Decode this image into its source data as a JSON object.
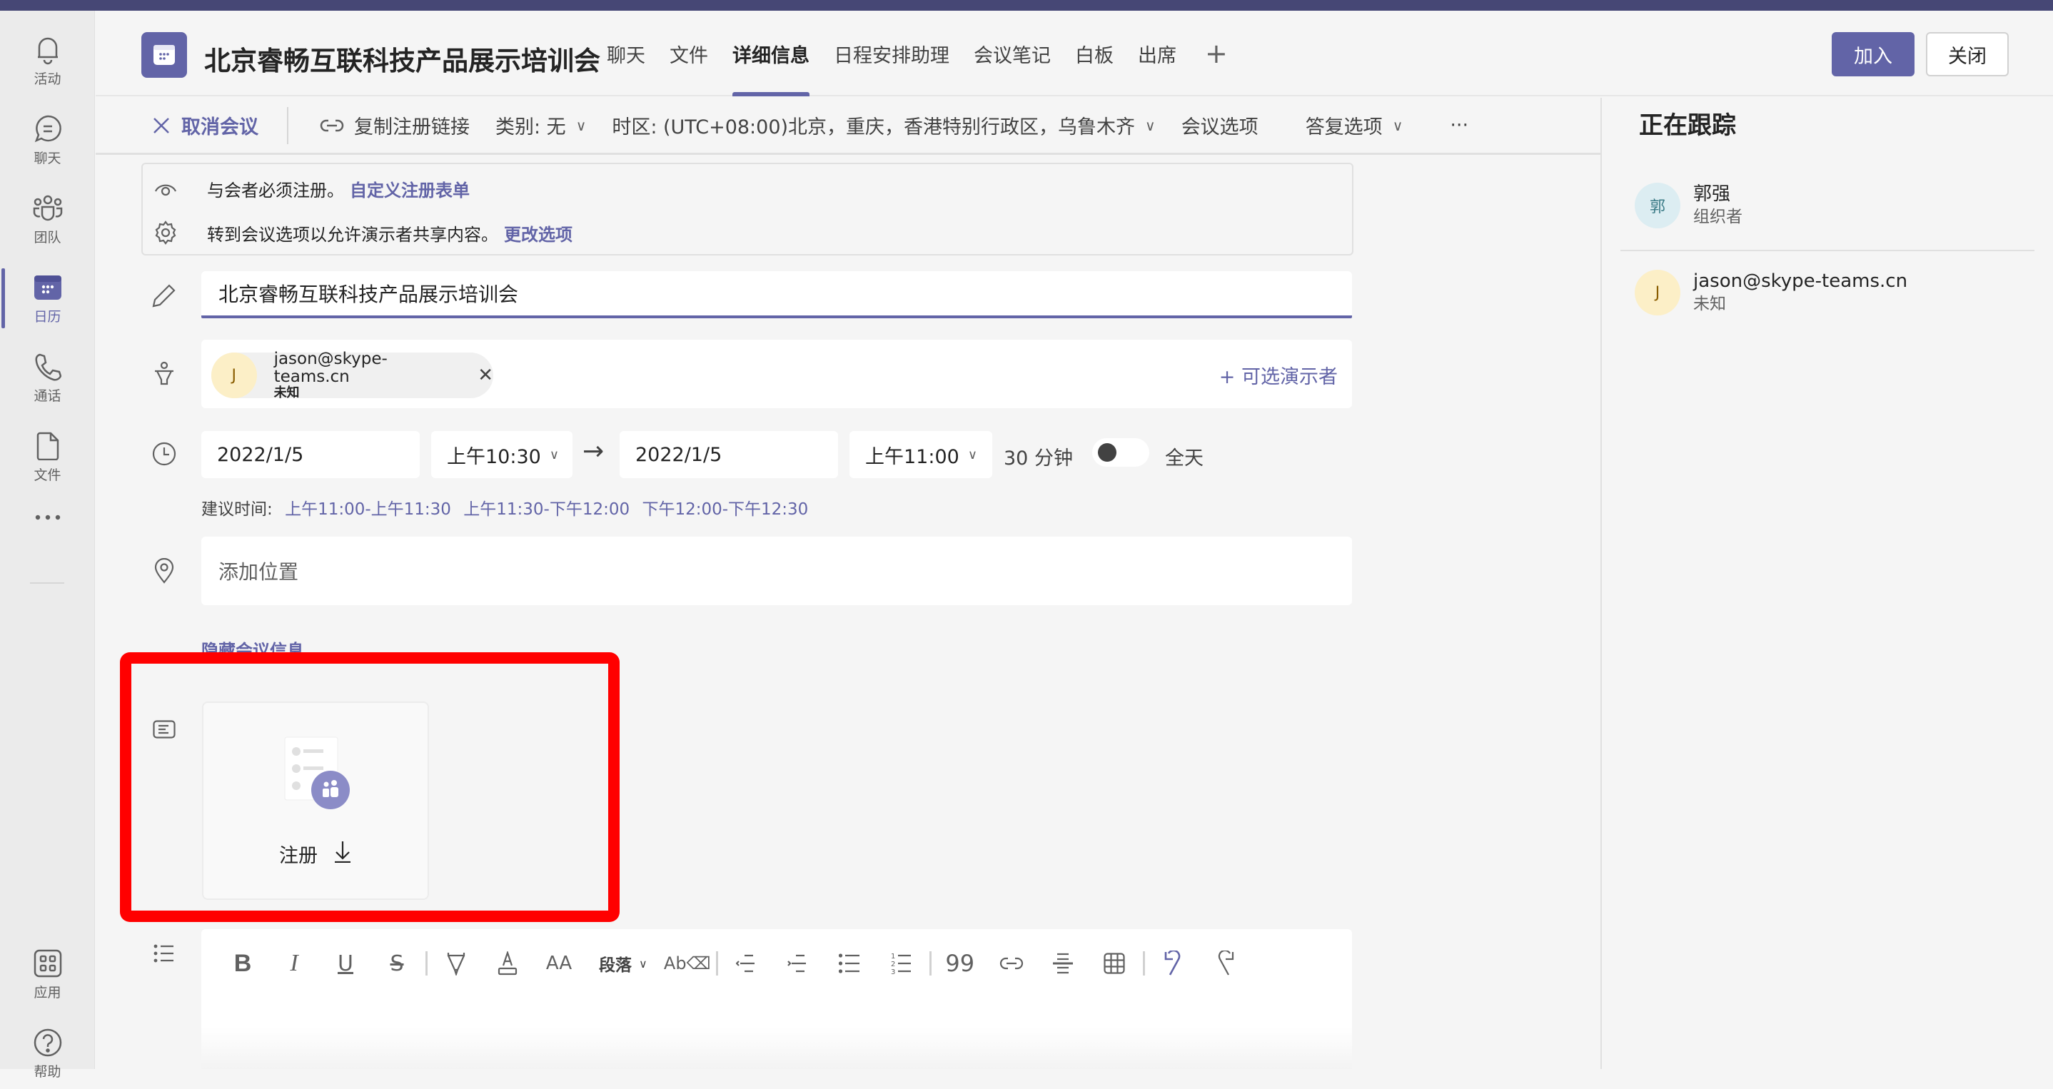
{
  "rail": {
    "items": [
      {
        "label": "活动",
        "icon": "bell-icon"
      },
      {
        "label": "聊天",
        "icon": "chat-icon"
      },
      {
        "label": "团队",
        "icon": "teams-icon"
      },
      {
        "label": "日历",
        "icon": "calendar-icon",
        "active": true
      },
      {
        "label": "通话",
        "icon": "phone-icon"
      },
      {
        "label": "文件",
        "icon": "file-icon"
      },
      {
        "label": "",
        "icon": "more-icon"
      }
    ],
    "bottom": [
      {
        "label": "应用",
        "icon": "apps-icon"
      },
      {
        "label": "帮助",
        "icon": "help-icon"
      }
    ]
  },
  "header": {
    "title": "北京睿畅互联科技产品展示培训会",
    "tabs": [
      "聊天",
      "文件",
      "详细信息",
      "日程安排助理",
      "会议笔记",
      "白板",
      "出席"
    ],
    "active_tab": "详细信息",
    "add_tab": "+",
    "join_label": "加入",
    "close_label": "关闭"
  },
  "commands": {
    "cancel": "取消会议",
    "copy_link": "复制注册链接",
    "category": "类别: 无",
    "timezone": "时区: (UTC+08:00)北京，重庆，香港特别行政区，乌鲁木齐",
    "meeting_options": "会议选项",
    "response_options": "答复选项",
    "more": "···"
  },
  "banner": {
    "line1": "与会者必须注册。",
    "link1": "自定义注册表单",
    "line2": "转到会议选项以允许演示者共享内容。",
    "link2": "更改选项"
  },
  "form": {
    "title_value": "北京睿畅互联科技产品展示培训会",
    "presenter": {
      "initial": "J",
      "email": "jason@skype-teams.cn",
      "status": "未知"
    },
    "optional_presenter": "+ 可选演示者",
    "start_date": "2022/1/5",
    "start_time": "上午10:30",
    "end_date": "2022/1/5",
    "end_time": "上午11:00",
    "duration": "30 分钟",
    "all_day_label": "全天",
    "all_day": false,
    "suggest_label": "建议时间:",
    "suggestions": [
      "上午11:00-上午11:30",
      "上午11:30-下午12:00",
      "下午12:00-下午12:30"
    ],
    "location_placeholder": "添加位置",
    "hide_info": "隐藏会议信息",
    "registration_label": "注册",
    "paragraph_label": "段落"
  },
  "tracking": {
    "title": "正在跟踪",
    "people": [
      {
        "initial": "郭",
        "name": "郭强",
        "role": "组织者"
      },
      {
        "initial": "J",
        "name": "jason@skype-teams.cn",
        "role": "未知"
      }
    ]
  },
  "colors": {
    "accent": "#6264a7",
    "topbar": "#464775",
    "highlight": "#ff0000"
  }
}
